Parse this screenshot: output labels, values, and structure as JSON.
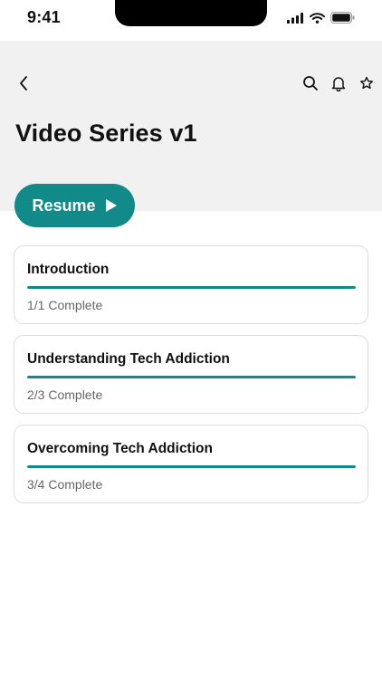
{
  "status_bar": {
    "time": "9:41",
    "icons": [
      "signal-icon",
      "wifi-icon",
      "battery-icon"
    ]
  },
  "header": {
    "back_icon": "chevron-left-icon",
    "actions": [
      {
        "icon": "search-icon"
      },
      {
        "icon": "bell-icon"
      },
      {
        "icon": "star-icon"
      }
    ],
    "title": "Video Series v1"
  },
  "resume": {
    "label": "Resume",
    "icon": "play-icon"
  },
  "modules": [
    {
      "title": "Introduction",
      "status": "1/1 Complete",
      "progress": 1.0
    },
    {
      "title": "Understanding Tech Addiction",
      "status": "2/3 Complete",
      "progress": 1.0
    },
    {
      "title": "Overcoming Tech Addiction",
      "status": "3/4 Complete",
      "progress": 1.0
    }
  ],
  "colors": {
    "accent": "#138a8a",
    "header_background": "#f1f1f1",
    "card_border": "#dcdcdc",
    "muted_text": "#666666"
  }
}
